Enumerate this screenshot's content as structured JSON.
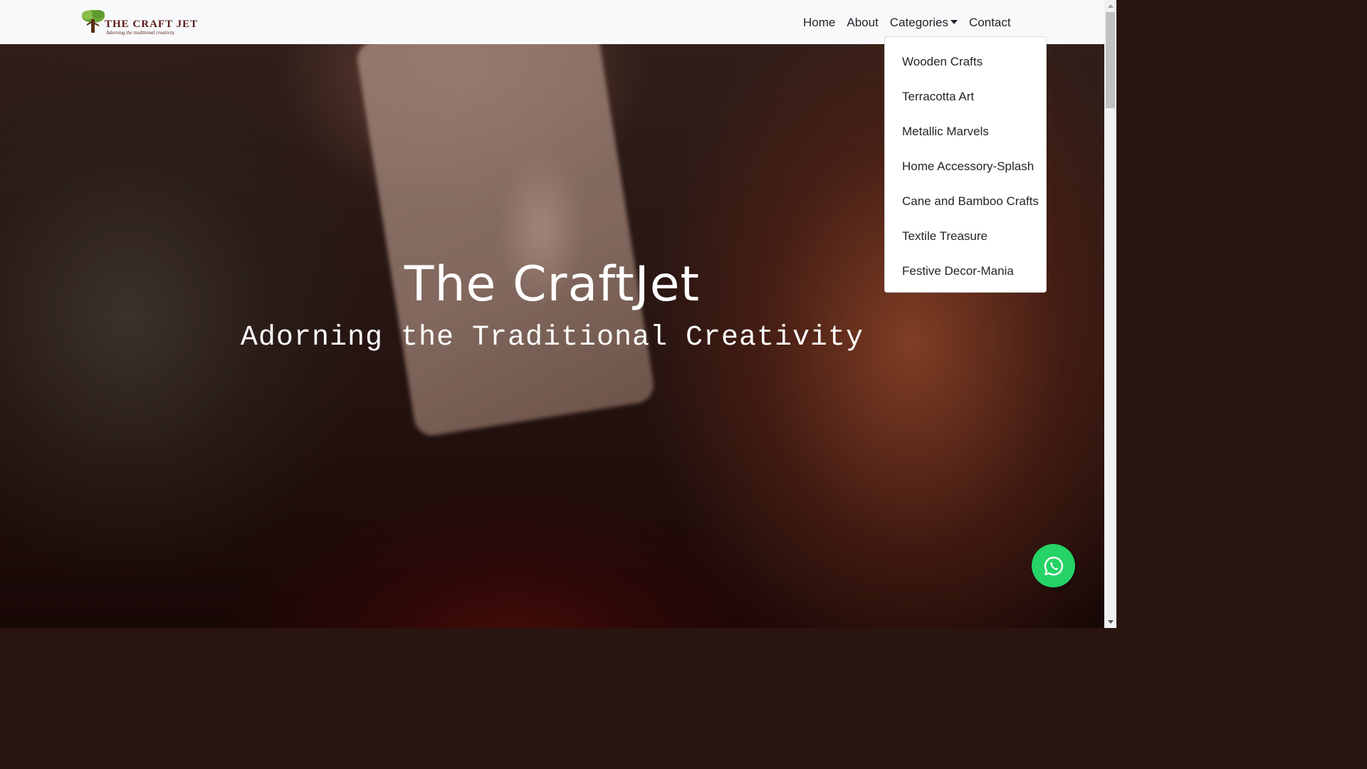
{
  "brand": {
    "logo_name": "THE CRAFT JET",
    "logo_tagline": "Adorning the traditional creativity"
  },
  "nav": {
    "items": [
      {
        "label": "Home"
      },
      {
        "label": "About"
      },
      {
        "label": "Categories"
      },
      {
        "label": "Contact"
      }
    ]
  },
  "categories_menu": {
    "items": [
      {
        "label": "Wooden Crafts"
      },
      {
        "label": "Terracotta Art"
      },
      {
        "label": "Metallic Marvels"
      },
      {
        "label": "Home Accessory-Splash"
      },
      {
        "label": "Cane and Bamboo Crafts"
      },
      {
        "label": "Textile Treasure"
      },
      {
        "label": "Festive Decor-Mania"
      }
    ]
  },
  "hero": {
    "title": "The CraftJet",
    "subtitle": "Adorning the Traditional Creativity"
  },
  "floating": {
    "icon": "whatsapp-icon",
    "color": "#25d366"
  },
  "colors": {
    "navbar_bg": "#f8f9fa",
    "text_dark": "#212529",
    "hero_text": "#ffffff"
  }
}
